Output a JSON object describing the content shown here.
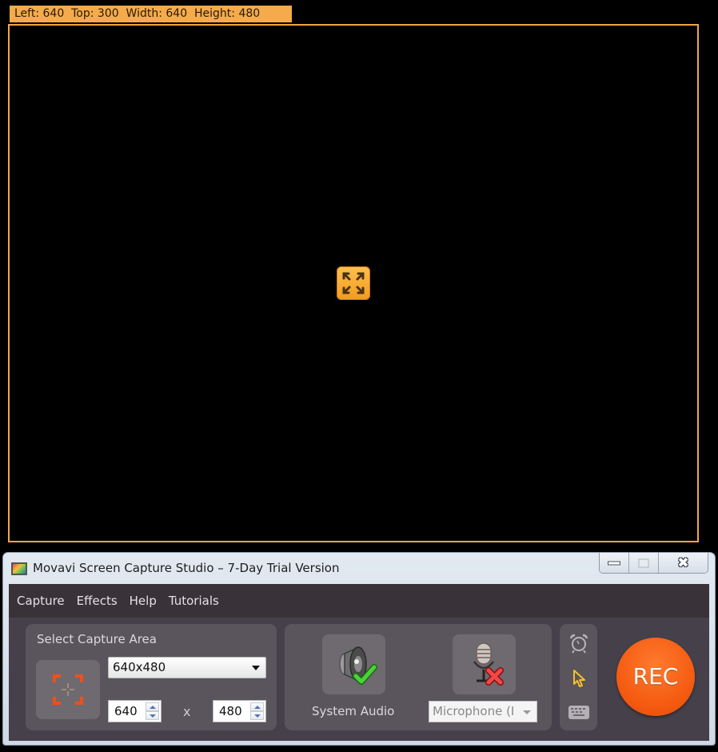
{
  "overlay": {
    "info_label": "Left: 640  Top: 300  Width: 640  Height: 480",
    "move_handle_icon": "expand-arrows-icon",
    "frame_color": "#f1a64a"
  },
  "window": {
    "title": "Movavi Screen Capture Studio – 7-Day Trial Version",
    "icons": {
      "app": "movavi-app-icon",
      "minimize": "minimize-icon",
      "maximize": "maximize-icon",
      "close": "close-icon"
    },
    "close_glyph": "✖"
  },
  "menu": {
    "items": [
      {
        "label": "Capture"
      },
      {
        "label": "Effects"
      },
      {
        "label": "Help"
      },
      {
        "label": "Tutorials"
      }
    ]
  },
  "capture_area": {
    "title": "Select Capture Area",
    "button_icon": "crosshair-frame-icon",
    "preset": "640x480",
    "width": "640",
    "height": "480",
    "separator": "x"
  },
  "audio": {
    "system_audio_label": "System Audio",
    "system_audio_enabled": true,
    "microphone_select": "Microphone (I",
    "microphone_enabled": false
  },
  "tools": [
    {
      "name": "scheduler-alarm-icon"
    },
    {
      "name": "cursor-effects-icon"
    },
    {
      "name": "keystrokes-keyboard-icon"
    }
  ],
  "rec": {
    "label": "REC",
    "color": "#f45a10"
  }
}
